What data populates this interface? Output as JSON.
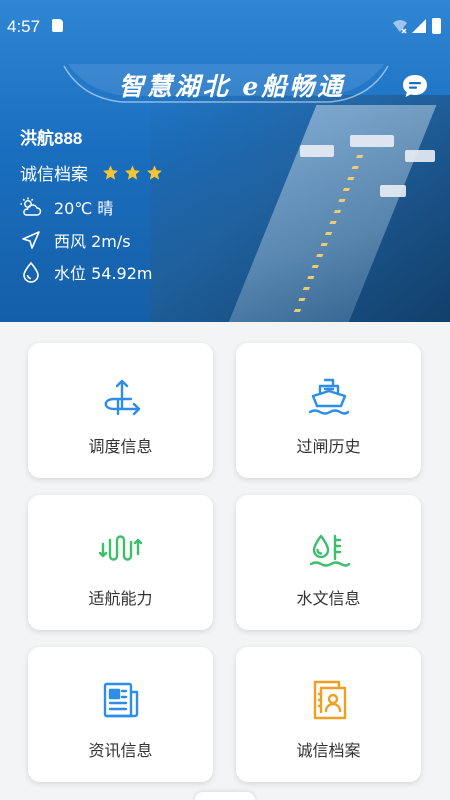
{
  "status_bar": {
    "time": "4:57"
  },
  "banner": {
    "slogan": "智慧湖北 e船畅通"
  },
  "ship": {
    "name": "洪航888",
    "credit_label": "诚信档案",
    "credit_stars": 3,
    "weather": "20℃ 晴",
    "wind": "西风 2m/s",
    "water_level": "水位 54.92m"
  },
  "menu": [
    {
      "label": "调度信息",
      "icon": "dispatch-icon",
      "color": "#2d8ee8"
    },
    {
      "label": "过闸历史",
      "icon": "ship-icon",
      "color": "#2d8ee8"
    },
    {
      "label": "适航能力",
      "icon": "navigability-icon",
      "color": "#3bbf6b"
    },
    {
      "label": "水文信息",
      "icon": "hydrology-icon",
      "color": "#3bbf6b"
    },
    {
      "label": "资讯信息",
      "icon": "news-icon",
      "color": "#2d8ee8"
    },
    {
      "label": "诚信档案",
      "icon": "credit-file-icon",
      "color": "#f0a020"
    }
  ],
  "colors": {
    "header_blue": "#1a6fc0",
    "star_yellow": "#f7c531",
    "background": "#f3f4f6"
  }
}
